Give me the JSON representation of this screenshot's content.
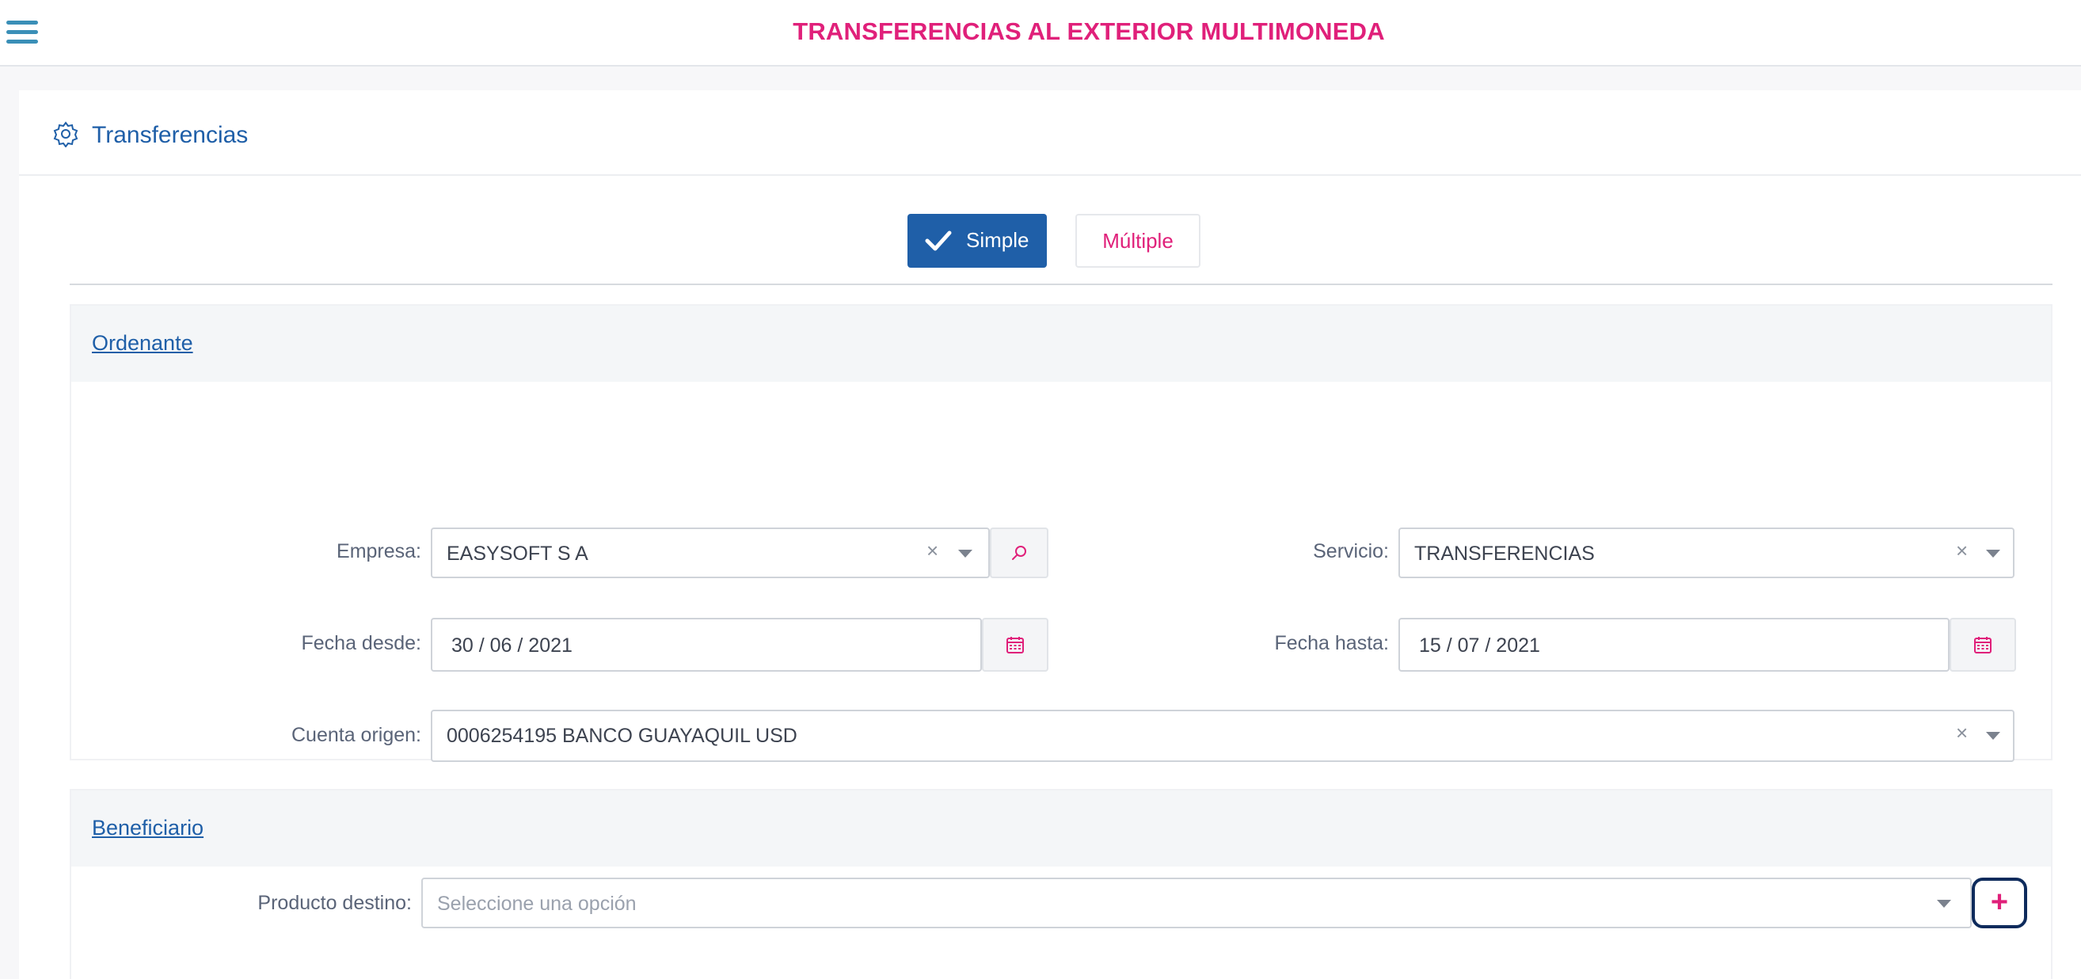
{
  "header": {
    "title": "TRANSFERENCIAS AL EXTERIOR MULTIMONEDA",
    "menu_icon": "hamburger-icon"
  },
  "card": {
    "title": "Transferencias",
    "icon": "gear-icon"
  },
  "mode_toggle": {
    "simple_label": "Simple",
    "multiple_label": "Múltiple",
    "selected": "Simple"
  },
  "ordenante": {
    "title": "Ordenante",
    "empresa": {
      "label": "Empresa:",
      "value": "EASYSOFT S A"
    },
    "servicio": {
      "label": "Servicio:",
      "value": "TRANSFERENCIAS"
    },
    "fecha_desde": {
      "label": "Fecha desde:",
      "value": "30 / 06 / 2021"
    },
    "fecha_hasta": {
      "label": "Fecha hasta:",
      "value": "15 / 07 / 2021"
    },
    "cuenta_origen": {
      "label": "Cuenta origen:",
      "value": "0006254195 BANCO GUAYAQUIL USD"
    }
  },
  "beneficiario": {
    "title": "Beneficiario",
    "producto_destino": {
      "label": "Producto destino:",
      "placeholder": "Seleccione una opción"
    },
    "add_label": "+"
  },
  "colors": {
    "brand_pink": "#e0207a",
    "primary_blue": "#1f5fa8",
    "menu_blue": "#3a8fb7"
  }
}
